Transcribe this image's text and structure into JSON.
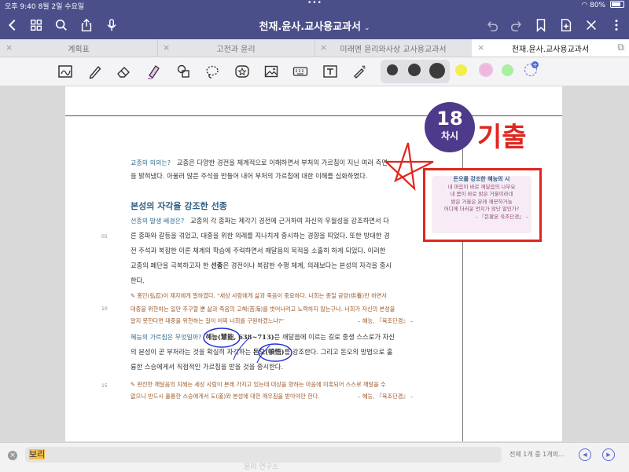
{
  "status": {
    "time_date": "오후 9:40  8월 2일 수요일",
    "dots": "•••",
    "battery": "80%"
  },
  "nav": {
    "title": "천재.윤사.교사용교과서",
    "chevron": "⌄"
  },
  "tabs": [
    {
      "label": "계획표",
      "close": "×"
    },
    {
      "label": "고전과 윤리",
      "close": "×"
    },
    {
      "label": "미래엔 윤리와사상 교사용교과서",
      "close": "×"
    },
    {
      "label": "천재.윤사.교사용교과서",
      "close": "×",
      "active": true
    }
  ],
  "colors": {
    "accent": "#4a4f8a",
    "badge": "#4e3a8a",
    "annotation_red": "#e0261e",
    "annotation_blue": "#1f2fd0",
    "heading": "#2d5f82",
    "quote": "#9b5a2b"
  },
  "toolbar_colors": [
    "#3b3b3b",
    "#3b3b3b",
    "#3b3b3b",
    "#f3ee4c",
    "#f2b6de",
    "#a8ef9e"
  ],
  "page": {
    "p1_label": "교종의 의의는?",
    "p1_line1": "교종은 다양한 경전을 체계적으로 이해하면서 부처의 가르침이 지닌 여러 측면",
    "p1_line2": "을 밝혀냈다. 아울러 많은 주석을 만들어 내어 부처의 가르침에 대한 이해를 심화하였다.",
    "heading": "본성의 자각을 강조한 선종",
    "p2_label": "선종의 발생 배경은?",
    "p2_line1": "교종의 각 종파는 제각기 경전에 근거하여 자신의 우월성을 강조하면서 다",
    "p2_line2": "른 종파와 갈등을 겪었고, 대중을 위한 의례를 지나치게 중시하는 경향을 띠었다. 또한 방대한 경",
    "p2_line3": "전 주석과 복잡한 이론 체계의 학습에 주력하면서 깨달음의 목적을 소홀히 하게 되었다. 이러한",
    "p2_line4a": "교종의 폐단을 극복하고자 한 ",
    "p2_line4b": "선종",
    "p2_line4c": "은 경전이나 복잡한 수행 체계, 의례보다는 본성의 자각을 중시",
    "p2_line5": "한다.",
    "q1_line1": "홍인(弘忍)이 제자에게 말하였다. \"세상 사람에게 삶과 죽음이 중요하다. 너희는 종일 공양(供養)만 하면서",
    "q1_line2": "대중을 위한하는 일만 추구할 뿐 삶과 죽음의 고해(苦海)를 벗어나려고 노력하지 않는구나. 너희가 자신의 본성을",
    "q1_line3": "알지 못한다면 대중을 위한하는 길이 어찌 너희를 구원하겠느냐?\"",
    "q1_src": "– 혜능, 『육조단경』 –",
    "p3_label": "혜능의 가르침은 무엇일까?",
    "p3_line1a": "혜능(慧能, 638~713)",
    "p3_line1b": "은 깨달음에 이르는 길로 중생 스스로가 자신",
    "p3_line2a": "의 본성이 곧 부처라는 것을 확실히 자각하는 ",
    "p3_line2b": "돈오(頓悟)",
    "p3_line2c": "를 강조한다. 그리고 돈오의 방법으로 훌",
    "p3_line3": "륭한 스승에게서 직접적인 가르침을 받을 것을 중시한다.",
    "q2_line1": "완전한 깨달음의 지혜는 세상 사람이 본래 가지고 있는데 대상을 향하는 마음에 미혹되어 스스로 깨달을 수",
    "q2_line2": "없으니 반드시 훌륭한 스승에게서 도(道)와 본성에 대한 깨우침을 받아야만 한다.",
    "q2_src": "– 혜능, 『육조단경』 –",
    "line_no": {
      "a": "05",
      "b": "10",
      "c": "15"
    },
    "badge_num": "18",
    "badge_sub": "차시",
    "hand_text": "기출",
    "box_title": "돈오를 강조한 혜능의 시",
    "box_lines": [
      "내 마음이 바로 깨달음의 나무요",
      "내 몸이 바로 밝은 거울이라네",
      "밝은 거울은 본래 깨끗하거늘",
      "어디에 더러운 먼지가 앉단 말인가?"
    ],
    "box_src": "– 『돈황본 육조단경』 –"
  },
  "find": {
    "query": "보리",
    "count": "전체 1개 중 1개의...",
    "ghost": "윤리 연구소"
  }
}
